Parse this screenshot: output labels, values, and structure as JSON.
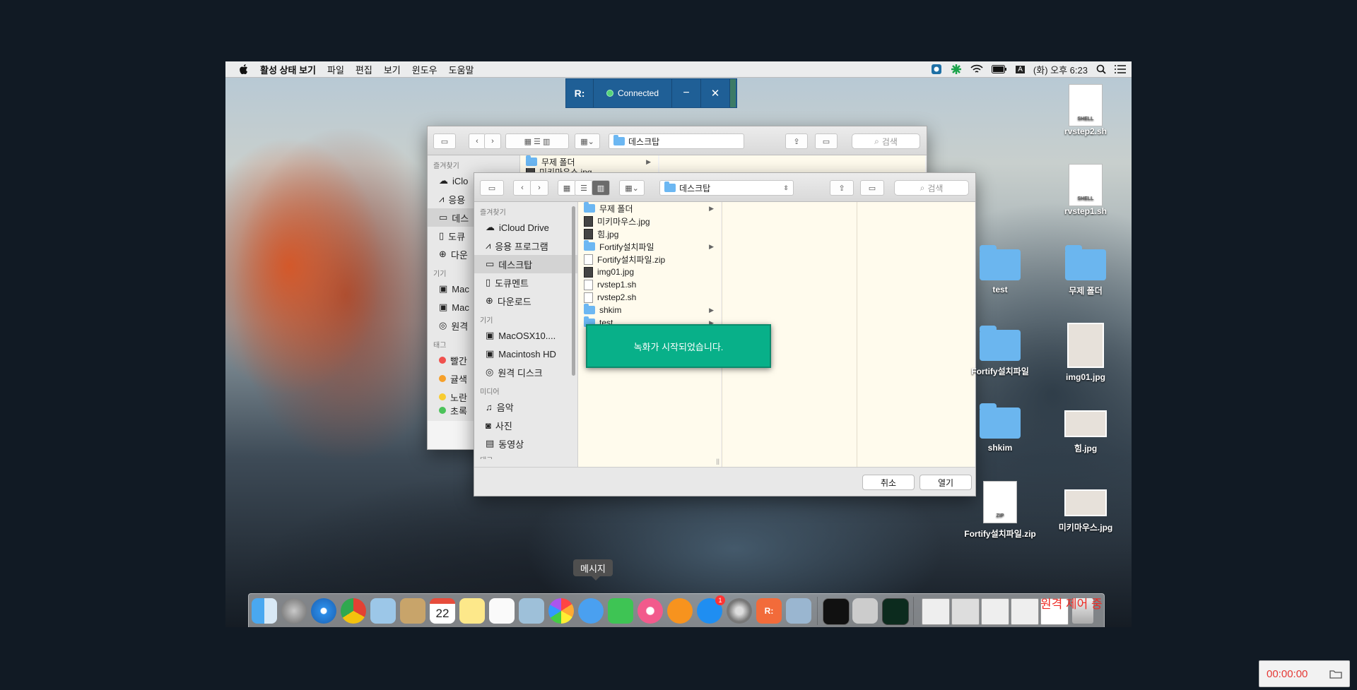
{
  "menubar": {
    "app": "활성 상태 보기",
    "items": [
      "파일",
      "편집",
      "보기",
      "윈도우",
      "도움말"
    ],
    "clock": "(화) 오후 6:23",
    "input_indicator": "A"
  },
  "remote_toolbar": {
    "logo": "R:",
    "status": "Connected",
    "minimize": "−",
    "close": "✕"
  },
  "back_window": {
    "path": "데스크탑",
    "search": "검색",
    "sidebar": {
      "favorites_title": "즐겨찾기",
      "items": [
        "iClo",
        "응용",
        "데스",
        "도큐",
        "다운"
      ],
      "devices_title": "기기",
      "devices": [
        "Mac",
        "Mac",
        "원격"
      ],
      "tags_title": "태그",
      "tags": [
        "빨간",
        "귤색",
        "노란",
        "초록"
      ]
    },
    "files": [
      "무제 폴더",
      "미키마우스.jpg"
    ]
  },
  "dialog": {
    "path": "데스크탑",
    "search": "검색",
    "sidebar": {
      "favorites_title": "즐겨찾기",
      "favorites": [
        "iCloud Drive",
        "응용 프로그램",
        "데스크탑",
        "도큐멘트",
        "다운로드"
      ],
      "devices_title": "기기",
      "devices": [
        "MacOSX10....",
        "Macintosh HD",
        "원격 디스크"
      ],
      "media_title": "미디어",
      "media": [
        "음악",
        "사진",
        "동영상"
      ],
      "tags_title": "태그"
    },
    "files": [
      {
        "name": "무제 폴더",
        "type": "folder"
      },
      {
        "name": "미키마우스.jpg",
        "type": "image"
      },
      {
        "name": "힘.jpg",
        "type": "image"
      },
      {
        "name": "Fortify설치파일",
        "type": "folder"
      },
      {
        "name": "Fortify설치파일.zip",
        "type": "zip"
      },
      {
        "name": "img01.jpg",
        "type": "image"
      },
      {
        "name": "rvstep1.sh",
        "type": "file"
      },
      {
        "name": "rvstep2.sh",
        "type": "file"
      },
      {
        "name": "shkim",
        "type": "folder"
      },
      {
        "name": "test",
        "type": "folder"
      }
    ],
    "cancel_label": "취소",
    "open_label": "열기"
  },
  "toast": "녹화가 시작되었습니다.",
  "desktop_items": {
    "rvstep2": {
      "label": "rvstep2.sh",
      "badge": "SHELL"
    },
    "rvstep1": {
      "label": "rvstep1.sh",
      "badge": "SHELL"
    },
    "test": "test",
    "untitled": "무제 폴더",
    "fortify_folder": "Fortify설치파일",
    "img01": "img01.jpg",
    "shkim": "shkim",
    "him": "힘.jpg",
    "fortify_zip": {
      "label": "Fortify설치파일.zip",
      "badge": "ZIP"
    },
    "mickey": "미키마우스.jpg"
  },
  "dock": {
    "tooltip": "메시지",
    "calendar_day": "22",
    "appstore_badge": "1",
    "overlay_text": "원격 제어 중"
  },
  "recording_timer": "00:00:00"
}
